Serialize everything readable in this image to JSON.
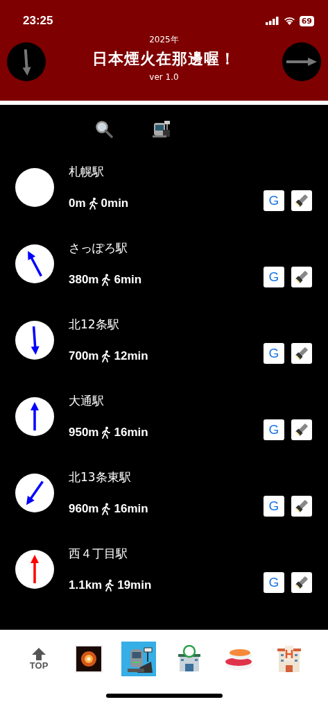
{
  "status_bar": {
    "time": "23:25",
    "battery": "69"
  },
  "header": {
    "year": "2025年",
    "title": "日本煙火在那邊喔！",
    "version": "ver 1.0",
    "left_compass": {
      "kind": "south"
    },
    "right_compass": {
      "kind": "east"
    }
  },
  "stations": [
    {
      "name": "札幌駅",
      "distance": "0m",
      "walk_time": "0min",
      "kind": "blank",
      "google_label": "G"
    },
    {
      "name": "さっぽろ駅",
      "distance": "380m",
      "walk_time": "6min",
      "kind": "northwest",
      "color": "#0000ff",
      "google_label": "G"
    },
    {
      "name": "北12条駅",
      "distance": "700m",
      "walk_time": "12min",
      "kind": "south",
      "color": "#0000ff",
      "google_label": "G"
    },
    {
      "name": "大通駅",
      "distance": "950m",
      "walk_time": "16min",
      "kind": "north",
      "color": "#0000ff",
      "google_label": "G"
    },
    {
      "name": "北13条東駅",
      "distance": "960m",
      "walk_time": "16min",
      "kind": "southwest",
      "color": "#0000ff",
      "google_label": "G"
    },
    {
      "name": "西４丁目駅",
      "distance": "1.1km",
      "walk_time": "19min",
      "kind": "north",
      "color": "#ff0000",
      "google_label": "G"
    }
  ],
  "tabs": [
    {
      "kind": "top",
      "label": "TOP",
      "selected": false
    },
    {
      "kind": "fireworks",
      "selected": false
    },
    {
      "kind": "station",
      "selected": true
    },
    {
      "kind": "store",
      "selected": false
    },
    {
      "kind": "sushi",
      "selected": false
    },
    {
      "kind": "hotel",
      "selected": false
    }
  ]
}
